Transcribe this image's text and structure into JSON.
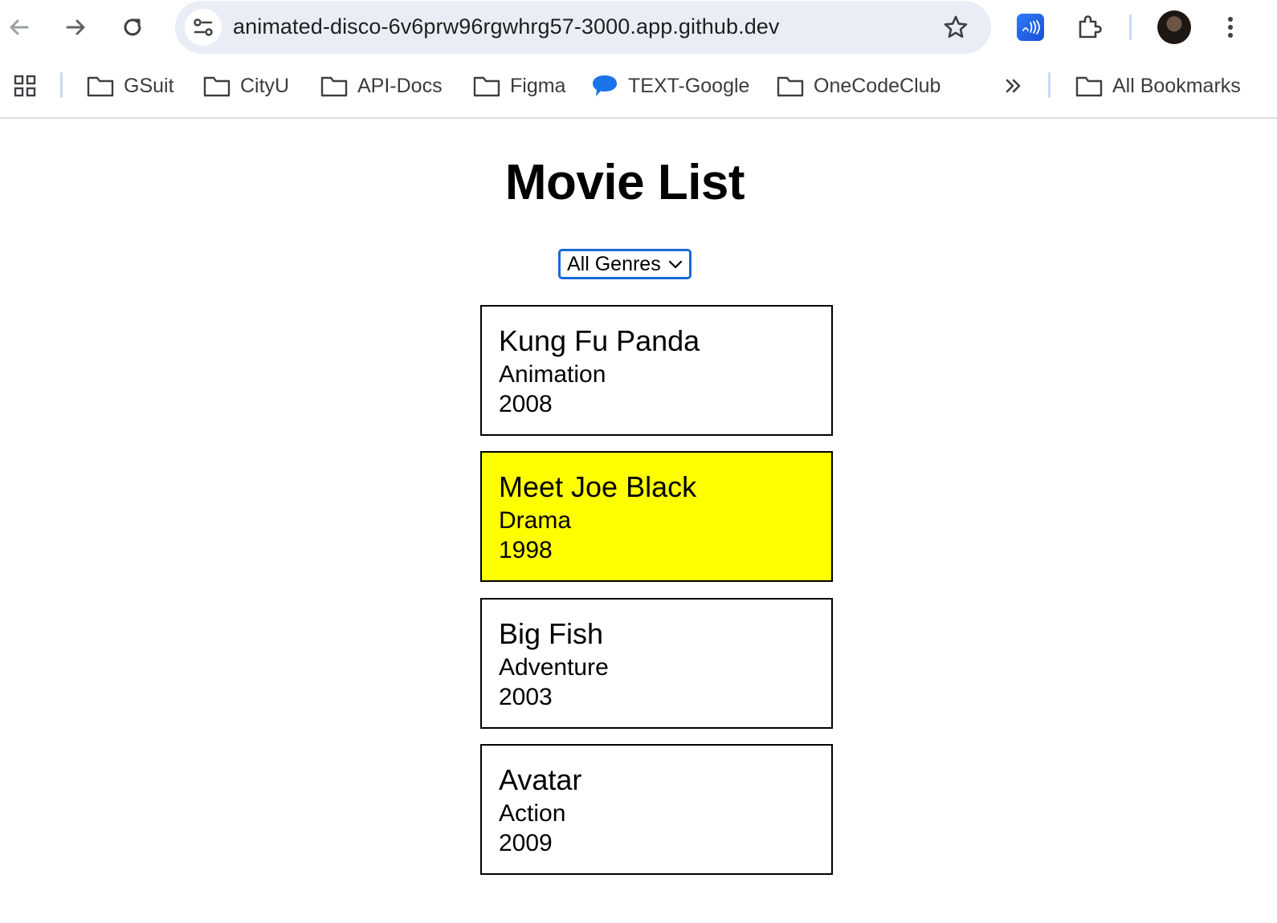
{
  "browser": {
    "url": "animated-disco-6v6prw96rgwhrg57-3000.app.github.dev",
    "bookmarks": [
      {
        "label": "GSuit",
        "icon": "folder-icon"
      },
      {
        "label": "CityU",
        "icon": "folder-icon"
      },
      {
        "label": "API-Docs",
        "icon": "folder-icon"
      },
      {
        "label": "Figma",
        "icon": "folder-icon"
      },
      {
        "label": "TEXT-Google",
        "icon": "message-bubble-icon"
      },
      {
        "label": "OneCodeClub",
        "icon": "folder-icon"
      }
    ],
    "all_bookmarks_label": "All Bookmarks"
  },
  "page": {
    "title": "Movie List",
    "genre_filter": {
      "selected": "All Genres"
    },
    "movies": [
      {
        "title": "Kung Fu Panda",
        "genre": "Animation",
        "year": "2008",
        "highlighted": false
      },
      {
        "title": "Meet Joe Black",
        "genre": "Drama",
        "year": "1998",
        "highlighted": true
      },
      {
        "title": "Big Fish",
        "genre": "Adventure",
        "year": "2003",
        "highlighted": false
      },
      {
        "title": "Avatar",
        "genre": "Action",
        "year": "2009",
        "highlighted": false
      }
    ]
  },
  "colors": {
    "highlight": "#ffff00",
    "select_focus_border": "#1a68d6",
    "omnibox_bg": "#e9eef6"
  }
}
